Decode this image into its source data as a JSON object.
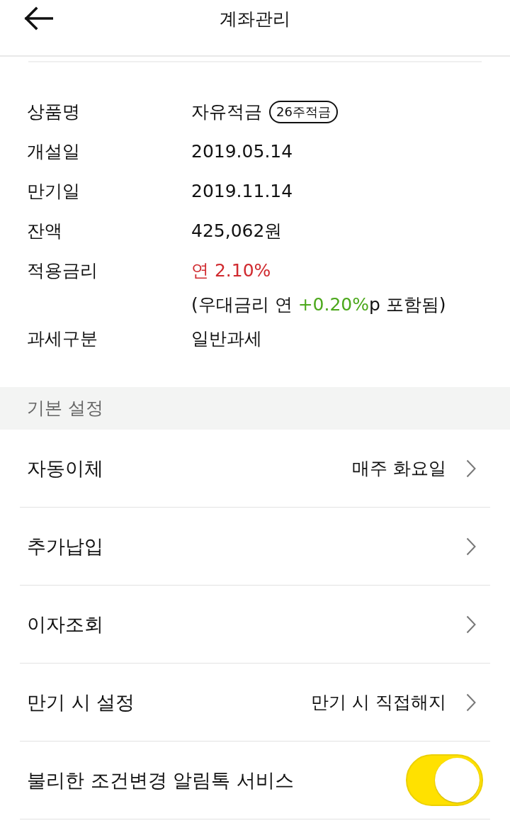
{
  "header": {
    "title": "계좌관리"
  },
  "details": [
    {
      "label": "상품명",
      "value": "자유적금",
      "badge": "26주적금"
    },
    {
      "label": "개설일",
      "value": "2019.05.14"
    },
    {
      "label": "만기일",
      "value": "2019.11.14"
    },
    {
      "label": "잔액",
      "value": "425,062원"
    },
    {
      "label": "적용금리",
      "value": "연 2.10%",
      "kind": "rate",
      "note": [
        {
          "text": "(우대금리 연 ",
          "emphasis": false
        },
        {
          "text": "+0.20%",
          "emphasis": true
        },
        {
          "text": "p 포함됨)",
          "emphasis": false
        }
      ]
    },
    {
      "label": "과세구분",
      "value": "일반과세"
    }
  ],
  "section": {
    "title": "기본 설정"
  },
  "settings": [
    {
      "label": "자동이체",
      "value": "매주 화요일",
      "kind": "link"
    },
    {
      "label": "추가납입",
      "kind": "link"
    },
    {
      "label": "이자조회",
      "kind": "link"
    },
    {
      "label": "만기 시 설정",
      "value": "만기 시 직접해지",
      "kind": "link"
    },
    {
      "label": "불리한 조건변경 알림톡 서비스",
      "kind": "toggle",
      "on": true
    }
  ]
}
